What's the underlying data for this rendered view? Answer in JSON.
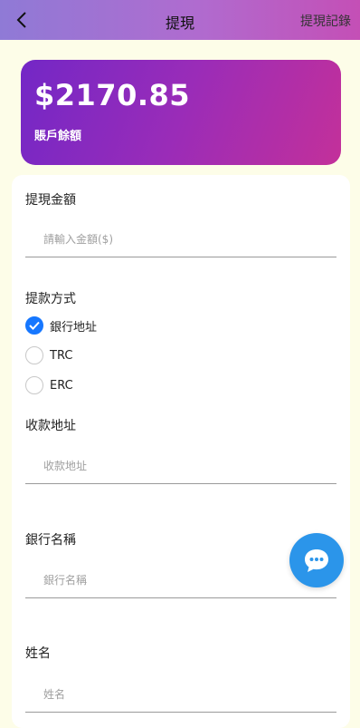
{
  "header": {
    "title": "提現",
    "records_label": "提現記錄",
    "back_icon": "chevron-left-icon",
    "gradient": [
      "#8f7ad6",
      "#c44fb6"
    ]
  },
  "balance": {
    "amount": "$2170.85",
    "label": "賬戶餘額",
    "gradient": [
      "#7327c6",
      "#c3309a"
    ]
  },
  "form": {
    "amount": {
      "label": "提現金額",
      "placeholder": "請輸入金額($)",
      "value": ""
    },
    "method": {
      "label": "提款方式",
      "options": [
        {
          "label": "銀行地址",
          "checked": true
        },
        {
          "label": "TRC",
          "checked": false
        },
        {
          "label": "ERC",
          "checked": false
        }
      ]
    },
    "address": {
      "label": "收款地址",
      "placeholder": "收款地址",
      "value": ""
    },
    "bank_name": {
      "label": "銀行名稱",
      "placeholder": "銀行名稱",
      "value": ""
    },
    "name": {
      "label": "姓名",
      "placeholder": "姓名",
      "value": ""
    }
  },
  "chat_button": {
    "icon": "chat-bubble-icon",
    "color": "#2b95ea"
  },
  "colors": {
    "accent": "#1677ff",
    "page_bg": "#fdfde8"
  }
}
